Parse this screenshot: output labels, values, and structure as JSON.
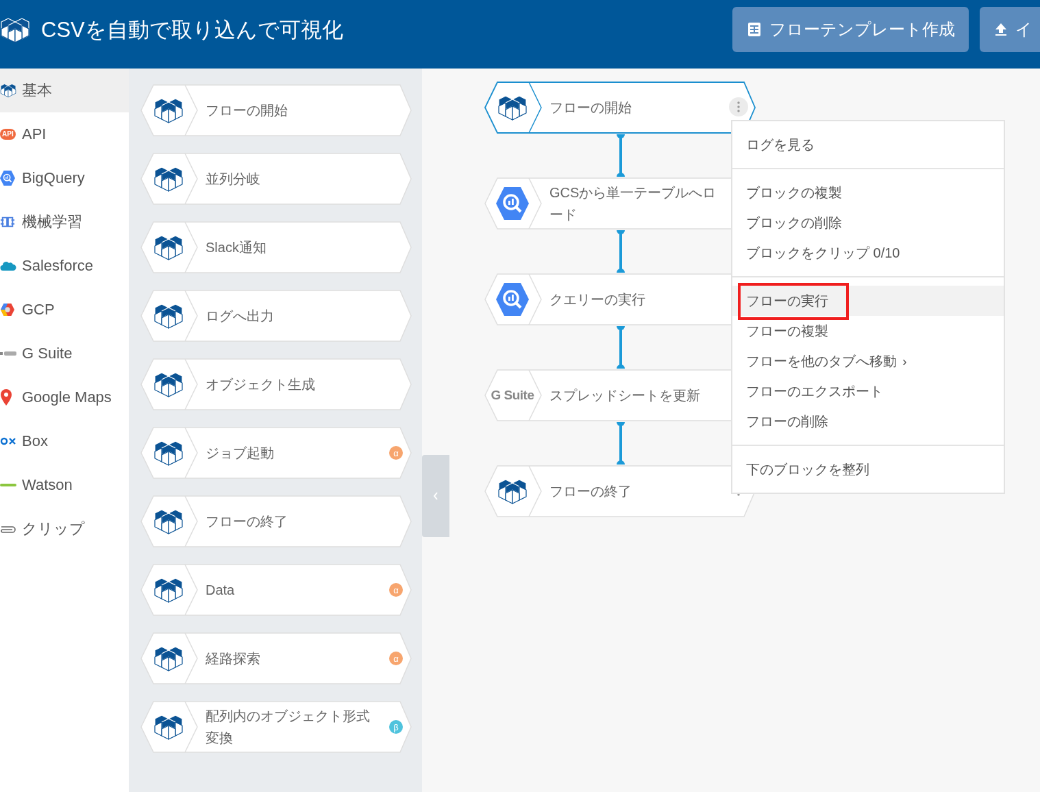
{
  "header": {
    "title": "CSVを自動で取り込んで可視化",
    "buttons": [
      {
        "label": "フローテンプレート作成",
        "kind": "template"
      },
      {
        "label": "イ",
        "kind": "upload"
      }
    ]
  },
  "sidebar": {
    "items": [
      {
        "label": "基本",
        "kind": "cube",
        "selected": true
      },
      {
        "label": "API",
        "kind": "api",
        "logo_text": "API",
        "selected": false
      },
      {
        "label": "BigQuery",
        "kind": "bigquery",
        "selected": false
      },
      {
        "label": "機械学習",
        "kind": "brain",
        "selected": false
      },
      {
        "label": "Salesforce",
        "kind": "cloud",
        "selected": false
      },
      {
        "label": "GCP",
        "kind": "gcp",
        "selected": false
      },
      {
        "label": "G Suite",
        "kind": "gsuite",
        "selected": false
      },
      {
        "label": "Google Maps",
        "kind": "pin",
        "selected": false
      },
      {
        "label": "Box",
        "kind": "box",
        "selected": false
      },
      {
        "label": "Watson",
        "kind": "watson",
        "selected": false
      },
      {
        "label": "クリップ",
        "kind": "clip",
        "selected": false
      }
    ]
  },
  "palette": {
    "blocks": [
      {
        "label": "フローの開始",
        "kind": "cube"
      },
      {
        "label": "並列分岐",
        "kind": "cube"
      },
      {
        "label": "Slack通知",
        "kind": "cube"
      },
      {
        "label": "ログへ出力",
        "kind": "cube"
      },
      {
        "label": "オブジェクト生成",
        "kind": "cube"
      },
      {
        "label": "ジョブ起動",
        "kind": "cube",
        "badge": "α",
        "color": "#f7a56e"
      },
      {
        "label": "フローの終了",
        "kind": "cube"
      },
      {
        "label": "Data",
        "kind": "cube",
        "badge": "α",
        "color": "#f7a56e"
      },
      {
        "label": "経路探索",
        "kind": "cube",
        "badge": "α",
        "color": "#f7a56e"
      },
      {
        "label": "配列内のオブジェクト形式変換",
        "kind": "cube",
        "badge": "β",
        "color": "#4fc3dd"
      }
    ]
  },
  "canvas": {
    "blocks": [
      {
        "label": "フローの開始",
        "kind": "cube",
        "selected": true,
        "menu_button": true
      },
      {
        "label": "GCSから単一テーブルへロード",
        "kind": "bigquery",
        "selected": false
      },
      {
        "label": "クエリーの実行",
        "kind": "bigquery",
        "selected": false
      },
      {
        "label": "スプレッドシートを更新",
        "kind": "gsuite",
        "logo_text": "G Suite",
        "selected": false
      },
      {
        "label": "フローの終了",
        "kind": "cube",
        "selected": false,
        "menu_button": true
      }
    ]
  },
  "context_menu": {
    "sections": [
      [
        {
          "label": "ログを見る",
          "selected": false
        }
      ],
      [
        {
          "label": "ブロックの複製",
          "selected": false
        },
        {
          "label": "ブロックの削除",
          "selected": false
        },
        {
          "label": "ブロックをクリップ 0/10",
          "selected": false
        }
      ],
      [
        {
          "label": "フローの実行",
          "selected": true,
          "annotated": true
        },
        {
          "label": "フローの複製",
          "selected": false
        },
        {
          "label": "フローを他のタブへ移動",
          "arrow": "›",
          "selected": false
        },
        {
          "label": "フローのエクスポート",
          "selected": false
        },
        {
          "label": "フローの削除",
          "selected": false
        }
      ],
      [
        {
          "label": "下のブロックを整列",
          "selected": false
        }
      ]
    ]
  }
}
